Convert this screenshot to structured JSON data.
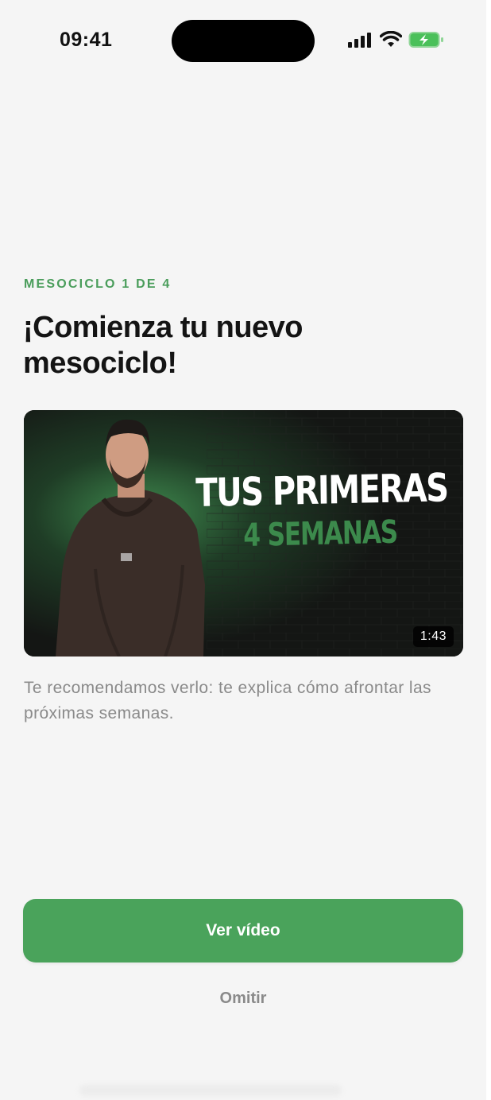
{
  "status_bar": {
    "time": "09:41",
    "icons": [
      "signal-icon",
      "wifi-icon",
      "battery-charging-icon"
    ],
    "battery_color": "#4bc05a"
  },
  "content": {
    "kicker": "MESOCICLO 1 DE 4",
    "title": "¡Comienza tu nuevo mesociclo!",
    "video": {
      "headline_line1": "TUS PRIMERAS",
      "headline_line2": "4 SEMANAS",
      "duration": "1:43",
      "hoodie_text": "LEVELAPP"
    },
    "description": "Te recomendamos verlo: te explica cómo afrontar las próximas semanas."
  },
  "actions": {
    "primary_label": "Ver vídeo",
    "skip_label": "Omitir"
  },
  "colors": {
    "accent": "#4aa35b",
    "kicker": "#4a9d5b",
    "background": "#f5f5f5"
  }
}
